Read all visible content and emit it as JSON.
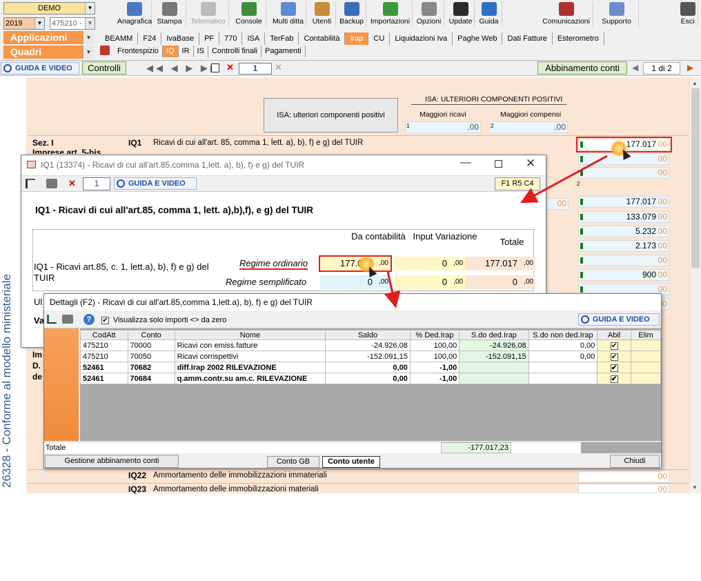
{
  "top": {
    "company": "DEMO",
    "year": "2019",
    "code": "475210 -",
    "applicazioni": "Applicazioni",
    "quadri": "Quadri",
    "buttons": [
      "Anagrafica",
      "Stampa",
      "Telematico",
      "Console",
      "Multi ditta",
      "Utenti",
      "Backup",
      "Importazioni",
      "Opzioni",
      "Update",
      "Guida",
      "Comunicazioni",
      "Supporto",
      "Esci"
    ],
    "tabs": [
      "BEAMM",
      "F24",
      "IvaBase",
      "PF",
      "770",
      "ISA",
      "TerFab",
      "Contabilità",
      "Irap",
      "CU",
      "Liquidazioni Iva",
      "Paghe Web",
      "Dati Fatture",
      "Esterometro"
    ],
    "active_tab": "Irap",
    "subtabs": [
      "Frontespizio",
      "IQ",
      "IR",
      "IS",
      "Controlli finali",
      "Pagamenti"
    ],
    "active_subtab": "IQ"
  },
  "bar2": {
    "guida": "GUIDA E VIDEO",
    "controlli": "Controlli",
    "page": "1",
    "abbinamento": "Abbinamento conti",
    "pager": "1 di 2"
  },
  "form": {
    "vertical_text": "26328 - Conforme al modello ministeriale",
    "isa_button": "ISA: ulteriori componenti positivi",
    "isa_header": "ISA: ULTERIORI COMPONENTI POSITIVI",
    "isa_col1": "Maggiori ricavi",
    "isa_col2": "Maggiori compensi",
    "isa_n1": "1",
    "isa_n2": "2",
    "isa_v1": ",00",
    "isa_v2": ",00",
    "sez": "Sez. I",
    "sez2": "Imprese art. 5-bis",
    "iq1_code": "IQ1",
    "iq1_text": "Ricavi di cui all'art. 85, comma 1, lett. a), b), f) e g) del TUIR",
    "iq22_code": "IQ22",
    "iq22_text": "Ammortamento delle immobilizzazioni immateriali",
    "iq23_code": "IQ23",
    "iq23_text": "Ammortamento delle immobilizzazioni materiali",
    "left_frag1": "Im",
    "left_frag2": "D.",
    "left_frag3": "de",
    "col_label": "2",
    "right_values": [
      "177.017",
      "",
      "",
      "",
      "177.017",
      "133.079",
      "5.232",
      "2.173",
      "",
      "900",
      "",
      ""
    ],
    "mid_value": "",
    "dec": "00"
  },
  "dlg1": {
    "title": "IQ1 (13374) - Ricavi di cui all'art.85,comma 1,lett. a), b), f) e g) del TUIR",
    "page": "1",
    "guida": "GUIDA E VIDEO",
    "ref": "F1 R5 C4",
    "heading": "IQ1 - Ricavi di cui all'art.85, comma 1, lett. a),b),f), e g) del TUIR",
    "row_label": "IQ1  - Ricavi art.85, c. 1, lett.a), b), f) e g) del TUIR",
    "col_contab": "Da contabilità",
    "col_input": "Input Variazione",
    "col_totale": "Totale",
    "reg_ord": "Regime ordinario",
    "reg_sempl": "Regime semplificato",
    "ord_contab": "177.017",
    "ord_input": "0",
    "ord_totale": "177.017",
    "sem_contab": "0",
    "sem_input": "0",
    "sem_totale": "0",
    "dec": ",00",
    "frag1": "Ul",
    "frag2": "Va"
  },
  "dlg2": {
    "title": "Dettagli (F2) - Ricavi di cui all'art.85,comma 1,lett.a), b), f) e g) del TUIR",
    "checkbox_label": "Visualizza solo importi <> da zero",
    "guida": "GUIDA E VIDEO",
    "columns": [
      "CodAtt",
      "Conto",
      "Nome",
      "Saldo",
      "% Ded.Irap",
      "S.do ded.Irap",
      "S.do non ded.Irap",
      "Abil",
      "Elim"
    ],
    "rows": [
      {
        "codatt": "475210",
        "conto": "70000",
        "nome": "Ricavi con emiss.fatture",
        "saldo": "-24.926,08",
        "ded": "100,00",
        "sded": "-24.926,08",
        "snonded": "0,00",
        "abil": "✔",
        "bold": false
      },
      {
        "codatt": "475210",
        "conto": "70050",
        "nome": "Ricavi corrispettivi",
        "saldo": "-152.091,15",
        "ded": "100,00",
        "sded": "-152.091,15",
        "snonded": "0,00",
        "abil": "✔",
        "bold": false
      },
      {
        "codatt": "52461",
        "conto": "70682",
        "nome": "diff.Irap 2002      RILEVAZIONE",
        "saldo": "0,00",
        "ded": "-1,00",
        "sded": "",
        "snonded": "",
        "abil": "✔",
        "bold": true
      },
      {
        "codatt": "52461",
        "conto": "70684",
        "nome": "q.amm.contr.su am.c. RILEVAZIONE",
        "saldo": "0,00",
        "ded": "-1,00",
        "sded": "",
        "snonded": "",
        "abil": "✔",
        "bold": true
      }
    ],
    "totale_label": "Totale",
    "totale_value": "-177.017,23",
    "btn_gestione": "Gestione abbinamento conti",
    "btn_gb": "Conto GB",
    "btn_utente": "Conto utente",
    "btn_chiudi": "Chiudi"
  }
}
